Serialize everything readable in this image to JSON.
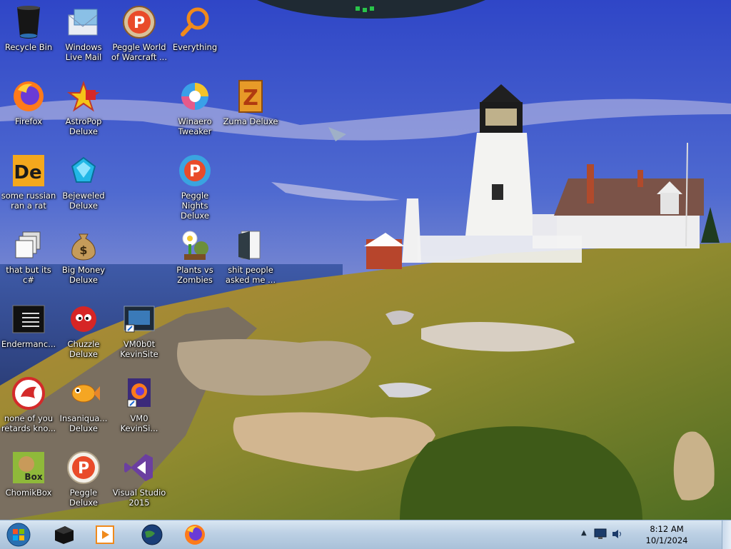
{
  "desktop": {
    "icons": [
      {
        "label": "Recycle Bin",
        "icon": "recycle-bin-icon"
      },
      {
        "label": "Windows Live Mail",
        "icon": "mail-icon"
      },
      {
        "label": "Peggle World of Warcraft ...",
        "icon": "peggle-icon"
      },
      {
        "label": "Everything",
        "icon": "search-magnifier-icon"
      },
      {
        "label": "Firefox",
        "icon": "firefox-icon"
      },
      {
        "label": "AstroPop Deluxe",
        "icon": "astropop-icon"
      },
      {
        "label": "Winaero Tweaker",
        "icon": "winaero-icon"
      },
      {
        "label": "Zuma Deluxe",
        "icon": "zuma-icon"
      },
      {
        "label": "some russian ran a rat",
        "icon": "de-app-icon"
      },
      {
        "label": "Bejeweled Deluxe",
        "icon": "gem-icon"
      },
      {
        "label": "Peggle Nights Deluxe",
        "icon": "peggle-nights-icon"
      },
      {
        "label": "that but its c#",
        "icon": "stacked-windows-icon"
      },
      {
        "label": "Big Money Deluxe",
        "icon": "money-bag-icon"
      },
      {
        "label": "Plants vs Zombies",
        "icon": "plants-vs-zombies-icon"
      },
      {
        "label": "shit people asked me ...",
        "icon": "folder-icon"
      },
      {
        "label": "Endermanc...",
        "icon": "terminal-icon"
      },
      {
        "label": "Chuzzle Deluxe",
        "icon": "chuzzle-icon"
      },
      {
        "label": "VM0b0t KevinSite",
        "icon": "vm-shortcut-icon"
      },
      {
        "label": "none of you retards kno...",
        "icon": "red-circle-app-icon"
      },
      {
        "label": "Insaniqua... Deluxe",
        "icon": "fish-icon"
      },
      {
        "label": "VM0 KevinSi...",
        "icon": "firefox-shortcut-icon"
      },
      {
        "label": "ChomikBox",
        "icon": "chomikbox-icon"
      },
      {
        "label": "Peggle Deluxe",
        "icon": "peggle-icon"
      },
      {
        "label": "Visual Studio 2015",
        "icon": "visual-studio-icon"
      }
    ]
  },
  "taskbar": {
    "start_icon": "windows-orb-icon",
    "pinned": [
      {
        "name": "black-box-app-icon"
      },
      {
        "name": "media-player-icon"
      },
      {
        "name": "globe-icon"
      },
      {
        "name": "firefox-icon"
      }
    ],
    "tray": {
      "time": "8:12 AM",
      "date": "10/1/2024"
    }
  },
  "colors": {
    "taskbar": "#bcd0e4",
    "sky": "#3f57c8",
    "accent": "#e0541c"
  }
}
